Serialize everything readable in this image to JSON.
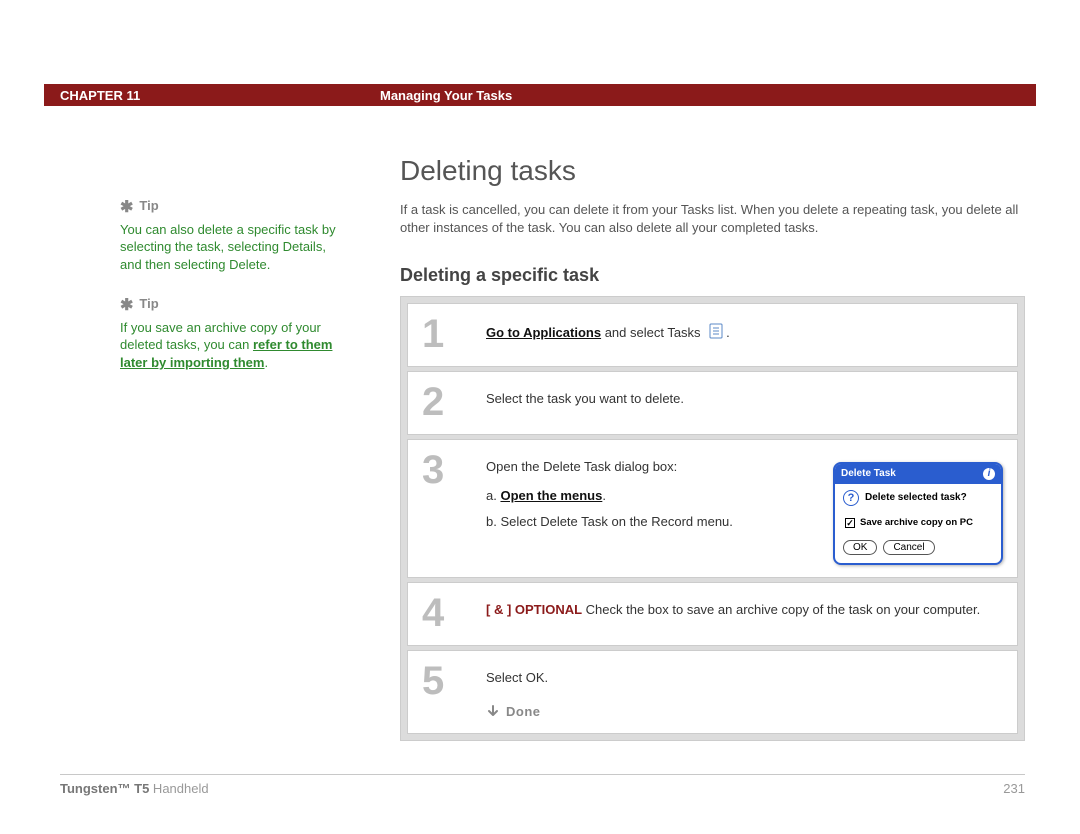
{
  "header": {
    "chapter": "CHAPTER 11",
    "title": "Managing Your Tasks"
  },
  "sidebar": {
    "tip_label": "Tip",
    "tip1_body": "You can also delete a specific task by selecting the task, selecting Details, and then selecting Delete.",
    "tip2_prefix": "If you save an archive copy of your deleted tasks, you can ",
    "tip2_link": "refer to them later by importing them",
    "tip2_suffix": "."
  },
  "main": {
    "section_title": "Deleting tasks",
    "section_para": "If a task is cancelled, you can delete it from your Tasks list. When you delete a repeating task, you delete all other instances of the task. You can also delete all your completed tasks.",
    "subsection_title": "Deleting a specific task",
    "steps": {
      "s1_num": "1",
      "s1_link": "Go to Applications",
      "s1_rest": " and select Tasks ",
      "s2_num": "2",
      "s2_text": "Select the task you want to delete.",
      "s3_num": "3",
      "s3_intro": "Open the Delete Task dialog box:",
      "s3_a_prefix": "a.  ",
      "s3_a_link": "Open the menus",
      "s3_a_suffix": ".",
      "s3_b": "b.  Select Delete Task on the Record menu.",
      "s4_num": "4",
      "s4_opt": "[ & ]  OPTIONAL",
      "s4_text": "   Check the box to save an archive copy of the task on your computer.",
      "s5_num": "5",
      "s5_text": "Select OK.",
      "done": "Done"
    },
    "dialog": {
      "title": "Delete Task",
      "question": "Delete selected task?",
      "checkbox": "Save archive copy on PC",
      "ok": "OK",
      "cancel": "Cancel"
    }
  },
  "footer": {
    "brand_bold": "Tungsten™ T5",
    "brand_rest": " Handheld",
    "page": "231"
  }
}
